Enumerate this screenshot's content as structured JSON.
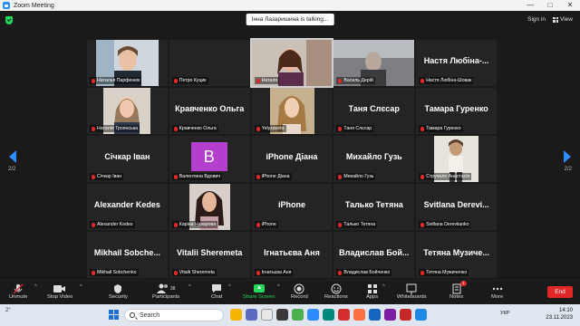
{
  "window": {
    "title": "Zoom Meeting",
    "controls": [
      "—",
      "□",
      "✕"
    ]
  },
  "topbar": {
    "talking_banner": "Інна Лазаришина is talking...",
    "sign_in": "Sign in",
    "view": "View"
  },
  "pagination": {
    "left": "2/2",
    "right": "2/2"
  },
  "gallery": [
    [
      {
        "name": "Наталья Парфенюк",
        "big": "",
        "video": "photo-a"
      },
      {
        "name": "Петро Куцик",
        "big": "",
        "video": "blank"
      },
      {
        "name": "Наталя",
        "big": "",
        "video": "photo-b",
        "speaking": true
      },
      {
        "name": "Василь Дерій",
        "big": "",
        "video": "photo-c"
      },
      {
        "name": "Настя Любіна-Шовак",
        "big": "Настя Любіна-...",
        "video": ""
      }
    ],
    [
      {
        "name": "Наталія Троянська",
        "big": "",
        "video": "photo-d"
      },
      {
        "name": "Кравченко Ольга",
        "big": "Кравченко Ольга",
        "video": ""
      },
      {
        "name": "Yelyzaveta",
        "big": "",
        "video": "photo-e"
      },
      {
        "name": "Таня Слєсар",
        "big": "Таня Слєсар",
        "video": ""
      },
      {
        "name": "Тамара Гуренко",
        "big": "Тамара Гуренко",
        "video": ""
      }
    ],
    [
      {
        "name": "Січкар Іван",
        "big": "Січкар Іван",
        "video": ""
      },
      {
        "name": "Валентина Вдович",
        "big": "",
        "video": "avatar-b",
        "avatar_letter": "B"
      },
      {
        "name": "iPhone Діана",
        "big": "iPhone Діана",
        "video": ""
      },
      {
        "name": "Михайло Гузь",
        "big": "Михайло Гузь",
        "video": ""
      },
      {
        "name": "Стручало Анастасія",
        "big": "",
        "video": "photo-f"
      }
    ],
    [
      {
        "name": "Alexander Kedes",
        "big": "Alexander Kedes",
        "video": ""
      },
      {
        "name": "Каріна Назарова",
        "big": "",
        "video": "photo-g"
      },
      {
        "name": "iPhone",
        "big": "iPhone",
        "video": ""
      },
      {
        "name": "Талько Тетяна",
        "big": "Талько Тетяна",
        "video": ""
      },
      {
        "name": "Svitlana Dereviianko",
        "big": "Svitlana Derevi...",
        "video": ""
      }
    ],
    [
      {
        "name": "Mikhail Sobchenko",
        "big": "Mikhail Sobche...",
        "video": ""
      },
      {
        "name": "Vitalii Sheremeta",
        "big": "Vitalii Sheremeta",
        "video": ""
      },
      {
        "name": "Ігнатьєва Аня",
        "big": "Ігнатьєва Аня",
        "video": ""
      },
      {
        "name": "Владислав Бойченко",
        "big": "Владислав Бой...",
        "video": ""
      },
      {
        "name": "Тетяна Мужиченко",
        "big": "Тетяна Музиче...",
        "video": ""
      }
    ]
  ],
  "toolbar": {
    "unmute": "Unmute",
    "stop_video": "Stop Video",
    "security": "Security",
    "participants": "Participants",
    "participants_count": "38",
    "chat": "Chat",
    "share_screen": "Share Screen",
    "record": "Record",
    "reactions": "Reactions",
    "apps": "Apps",
    "whiteboards": "Whiteboards",
    "notes": "Notes",
    "more": "More",
    "end": "End",
    "notes_badge": "1"
  },
  "taskbar": {
    "weather": "2°",
    "search_placeholder": "Search",
    "lang": "УКР",
    "time": "14:10",
    "date": "23.11.2023"
  },
  "colors": {
    "accent": "#2d8cff",
    "end_red": "#e02828",
    "share_green": "#23d959",
    "avatar_purple": "#b43fcf"
  }
}
